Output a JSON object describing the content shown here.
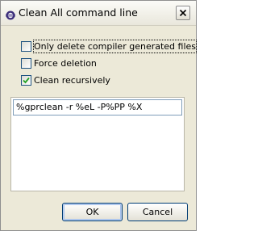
{
  "window": {
    "title": "Clean All command line",
    "title_icon": "eclipse-icon",
    "close_icon": "close-icon"
  },
  "options": [
    {
      "label": "Only delete compiler generated files",
      "checked": false,
      "focused": true
    },
    {
      "label": "Force deletion",
      "checked": false,
      "focused": false
    },
    {
      "label": "Clean recursively",
      "checked": true,
      "focused": false
    }
  ],
  "command_line": {
    "value": "%gprclean -r %eL -P%PP %X"
  },
  "buttons": {
    "ok_label": "OK",
    "cancel_label": "Cancel"
  },
  "colors": {
    "checkmark": "#21a121",
    "checkbox_border": "#1c5180",
    "button_border": "#003c74"
  }
}
